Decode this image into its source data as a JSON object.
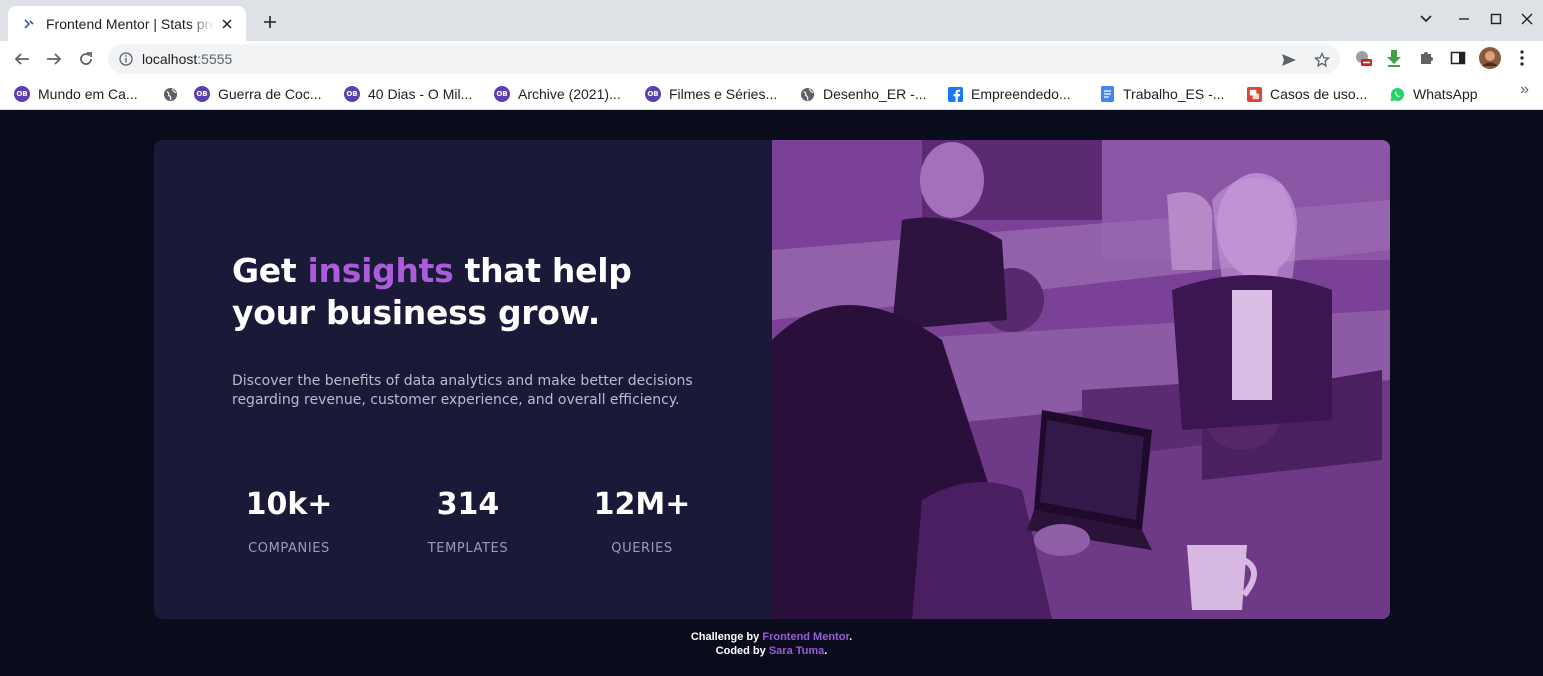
{
  "browser": {
    "tab_title": "Frontend Mentor | Stats preview card component",
    "url_host": "localhost",
    "url_port": ":5555",
    "bookmarks": [
      {
        "label": "Mundo em Ca...",
        "icon": "ob-icon"
      },
      {
        "label": "Guerra de Coc...",
        "icon": "ob-icon"
      },
      {
        "label": "40 Dias - O Mil...",
        "icon": "ob-icon"
      },
      {
        "label": "Archive (2021)...",
        "icon": "ob-icon"
      },
      {
        "label": "Filmes e Séries...",
        "icon": "ob-icon"
      },
      {
        "label": "Desenho_ER -...",
        "icon": "globe-icon"
      },
      {
        "label": "Empreendedo...",
        "icon": "facebook-icon"
      },
      {
        "label": "Trabalho_ES -...",
        "icon": "docs-icon"
      },
      {
        "label": "Casos de uso...",
        "icon": "slides-icon"
      },
      {
        "label": "WhatsApp",
        "icon": "whatsapp-icon"
      }
    ],
    "bookmark_more": "»",
    "ob_badge": "OB"
  },
  "card": {
    "headline_before": "Get ",
    "headline_accent": "insights",
    "headline_after": " that help your business grow.",
    "description": "Discover the benefits of data analytics and make better decisions regarding revenue, customer experience, and overall efficiency.",
    "stats": [
      {
        "value": "10k+",
        "label": "COMPANIES"
      },
      {
        "value": "314",
        "label": "TEMPLATES"
      },
      {
        "value": "12M+",
        "label": "QUERIES"
      }
    ]
  },
  "attribution": {
    "line1_prefix": "Challenge by ",
    "line1_link": "Frontend Mentor",
    "line1_suffix": ".",
    "line2_prefix": "Coded by ",
    "line2_link": "Sara Tuma",
    "line2_suffix": "."
  },
  "colors": {
    "page_bg": "#0a0c1c",
    "card_bg": "#1b1938",
    "accent": "#aa5cdb",
    "image_overlay": "#7b4196",
    "body_text": "#bdbacc",
    "stat_label": "#9d9ab5"
  }
}
